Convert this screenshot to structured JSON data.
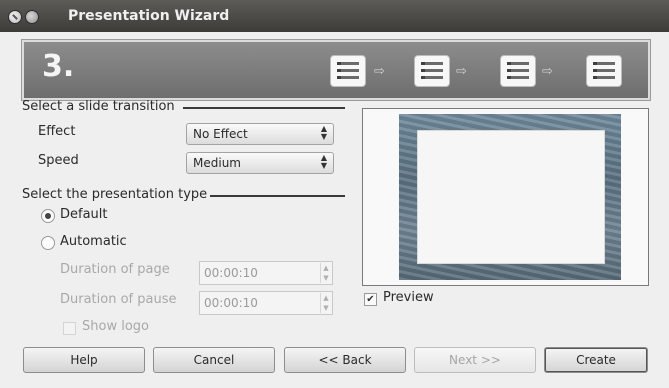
{
  "window": {
    "title": "Presentation Wizard"
  },
  "banner": {
    "step": "3.",
    "arrow": "⇨"
  },
  "transition": {
    "heading": "Select a slide transition",
    "effect_label": "Effect",
    "effect_value": "No Effect",
    "speed_label": "Speed",
    "speed_value": "Medium"
  },
  "presentation_type": {
    "heading": "Select the presentation type",
    "default_label": "Default",
    "automatic_label": "Automatic",
    "selected": "Default",
    "duration_page_label": "Duration of page",
    "duration_page_value": "00:00:10",
    "duration_pause_label": "Duration of pause",
    "duration_pause_value": "00:00:10",
    "show_logo_label": "Show logo"
  },
  "preview": {
    "label": "Preview",
    "checked": true
  },
  "buttons": {
    "help": "Help",
    "cancel": "Cancel",
    "back": "<< Back",
    "next": "Next >>",
    "create": "Create"
  }
}
